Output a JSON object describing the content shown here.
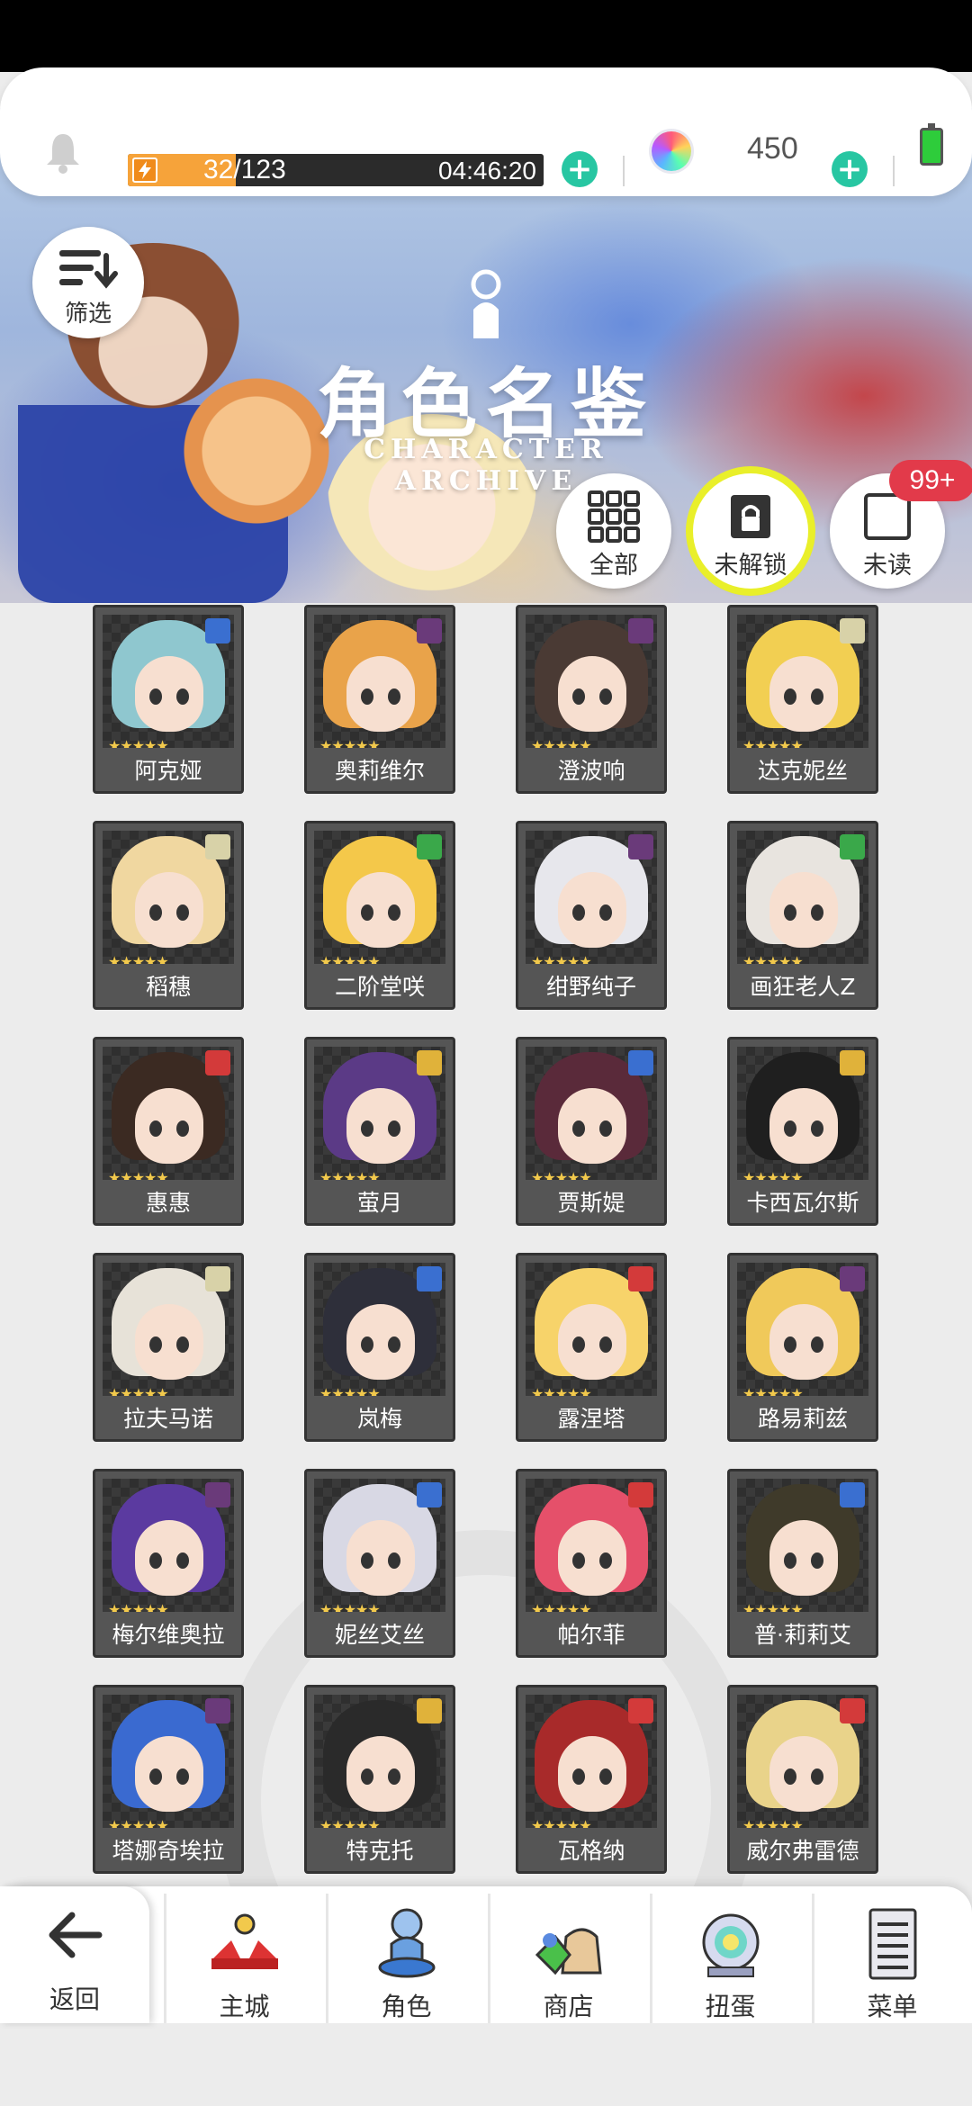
{
  "topbar": {
    "stamina_value": "32/123",
    "stamina_fraction": 0.26,
    "stamina_timer": "04:46:20",
    "gem_count": "450"
  },
  "banner": {
    "title_cn": "角色名鉴",
    "title_en": "CHARACTER ARCHIVE",
    "filter_label": "筛选"
  },
  "categories": {
    "all": "全部",
    "locked": "未解锁",
    "unread": "未读",
    "unread_badge": "99+"
  },
  "characters": [
    {
      "name": "阿克娅",
      "element": "water",
      "hair": "#8fc7cf"
    },
    {
      "name": "奥莉维尔",
      "element": "dark",
      "hair": "#e9a34a"
    },
    {
      "name": "澄波响",
      "element": "dark",
      "hair": "#4a3a34"
    },
    {
      "name": "达克妮丝",
      "element": "light",
      "hair": "#f2cf52"
    },
    {
      "name": "稻穗",
      "element": "light",
      "hair": "#f0d7a0"
    },
    {
      "name": "二阶堂咲",
      "element": "wind",
      "hair": "#f4c84a"
    },
    {
      "name": "绀野纯子",
      "element": "dark",
      "hair": "#e7e7ec"
    },
    {
      "name": "画狂老人Z",
      "element": "wind",
      "hair": "#e8e4df"
    },
    {
      "name": "惠惠",
      "element": "fire",
      "hair": "#3b2a22"
    },
    {
      "name": "萤月",
      "element": "thunder",
      "hair": "#5b3a86"
    },
    {
      "name": "贾斯媞",
      "element": "water",
      "hair": "#5a2a3a"
    },
    {
      "name": "卡西瓦尔斯",
      "element": "thunder",
      "hair": "#1f1f1f"
    },
    {
      "name": "拉夫马诺",
      "element": "light",
      "hair": "#e7e2d8"
    },
    {
      "name": "岚梅",
      "element": "water",
      "hair": "#2e2f3a"
    },
    {
      "name": "露涅塔",
      "element": "fire",
      "hair": "#f7d36a"
    },
    {
      "name": "路易莉兹",
      "element": "dark",
      "hair": "#f0c95a"
    },
    {
      "name": "梅尔维奥拉",
      "element": "dark",
      "hair": "#5b3aa0"
    },
    {
      "name": "妮丝艾丝",
      "element": "water",
      "hair": "#d8d8e4"
    },
    {
      "name": "帕尔菲",
      "element": "fire",
      "hair": "#e5506a"
    },
    {
      "name": "普·莉莉艾",
      "element": "water",
      "hair": "#3f3a2a"
    },
    {
      "name": "塔娜奇埃拉",
      "element": "dark",
      "hair": "#3a6ad0"
    },
    {
      "name": "特克托",
      "element": "thunder",
      "hair": "#2a2a2a"
    },
    {
      "name": "瓦格纳",
      "element": "fire",
      "hair": "#a82a2a"
    },
    {
      "name": "威尔弗雷德",
      "element": "fire",
      "hair": "#e9d38a"
    }
  ],
  "element_colors": {
    "water": "#3a6fd0",
    "dark": "#6a3a7a",
    "light": "#d8d2a8",
    "wind": "#3aa84a",
    "fire": "#d33a3a",
    "thunder": "#e0b23a"
  },
  "stars": "★★★★★",
  "nav": {
    "back": "返回",
    "home": "主城",
    "characters": "角色",
    "shop": "商店",
    "gacha": "扭蛋",
    "menu": "菜单"
  }
}
